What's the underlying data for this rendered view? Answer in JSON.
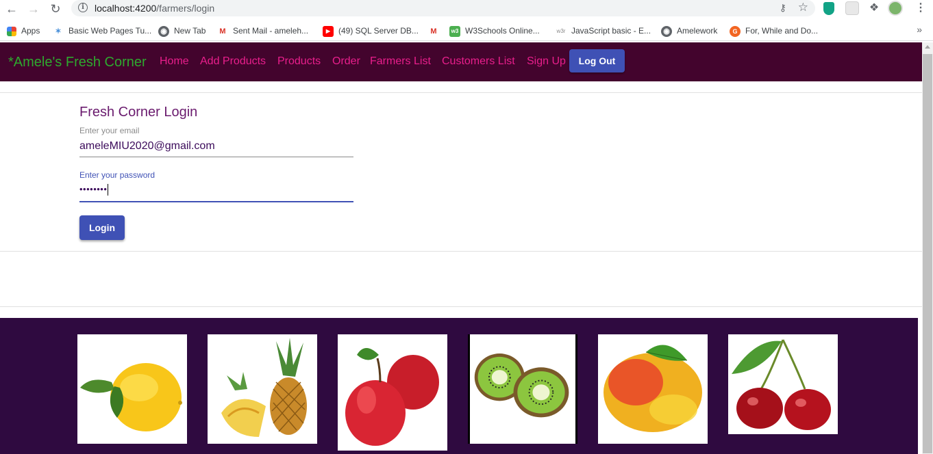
{
  "browser": {
    "url_host": "localhost:4200",
    "url_path": "/farmers/login",
    "bookmarks": [
      {
        "label": "Apps",
        "icon": "apps-grid-icon"
      },
      {
        "label": "Basic Web Pages Tu...",
        "icon": "web-pages-icon"
      },
      {
        "label": "New Tab",
        "icon": "globe-icon"
      },
      {
        "label": "Sent Mail - ameleh...",
        "icon": "gmail-icon"
      },
      {
        "label": "(49) SQL Server DB...",
        "icon": "youtube-icon"
      },
      {
        "label": "",
        "icon": "gmail-icon"
      },
      {
        "label": "W3Schools Online...",
        "icon": "w3schools-icon"
      },
      {
        "label": "JavaScript basic - E...",
        "icon": "w3resource-icon"
      },
      {
        "label": "Amelework",
        "icon": "globe-icon"
      },
      {
        "label": "For, While and Do...",
        "icon": "guru-icon"
      }
    ]
  },
  "navbar": {
    "brand": "*Amele's Fresh Corner",
    "links": [
      "Home",
      "Add Products",
      "Products",
      "Order",
      "Farmers List",
      "Customers List",
      "Sign Up"
    ],
    "logout_label": "Log Out",
    "background": "#43042d",
    "link_color": "#e91e8c",
    "brand_color": "#2ea92e"
  },
  "login": {
    "title": "Fresh Corner Login",
    "email_label": "Enter your email",
    "email_value": "ameleMIU2020@gmail.com",
    "password_label": "Enter your password",
    "password_value": "••••••••",
    "button_label": "Login",
    "accent": "#3f51b5"
  },
  "footer": {
    "background": "#2f0a40",
    "fruits": [
      "lemon",
      "pineapple",
      "apple",
      "kiwi",
      "mango",
      "cherry"
    ]
  }
}
